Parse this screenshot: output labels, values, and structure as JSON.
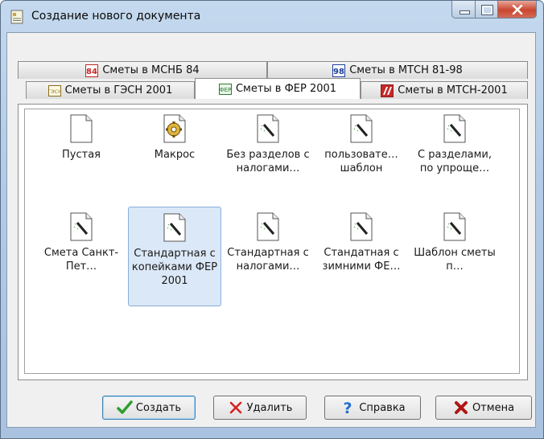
{
  "window": {
    "title": "Создание нового документа"
  },
  "tabs": {
    "row1": [
      {
        "label": "Сметы в МСНБ 84",
        "badge": "84"
      },
      {
        "label": "Сметы в МТСН 81-98",
        "badge": "98"
      }
    ],
    "row2": [
      {
        "label": "Сметы в ГЭСН 2001",
        "badge": "ГЭСН"
      },
      {
        "label": "Сметы в ФЕР 2001",
        "badge": "ФЕР"
      },
      {
        "label": "Сметы в МТСН-2001",
        "badge": ""
      }
    ],
    "active": "Сметы в ФЕР 2001"
  },
  "templates": [
    {
      "label": "Пустая",
      "icon": "blank-document-icon"
    },
    {
      "label": "Макрос",
      "icon": "macro-icon"
    },
    {
      "label": "Без разделов с налогами…",
      "icon": "template-wand-icon"
    },
    {
      "label": "пользовате… шаблон",
      "icon": "template-wand-icon"
    },
    {
      "label": "С разделами, по упроще…",
      "icon": "template-wand-icon"
    },
    {
      "label": "Смета Санкт-Пет…",
      "icon": "template-wand-icon"
    },
    {
      "label": "Стандартная с копейками ФЕР 2001",
      "icon": "template-wand-icon",
      "selected": true
    },
    {
      "label": "Стандартная с налогами…",
      "icon": "template-wand-icon"
    },
    {
      "label": "Стандатная с зимними ФЕ…",
      "icon": "template-wand-icon"
    },
    {
      "label": "Шаблон сметы п…",
      "icon": "template-wand-icon"
    }
  ],
  "buttons": {
    "create": "Создать",
    "delete": "Удалить",
    "help": "Справка",
    "cancel": "Отмена"
  },
  "colors": {
    "accent": "#3c7fb1",
    "selection": "#dbe8f7"
  }
}
